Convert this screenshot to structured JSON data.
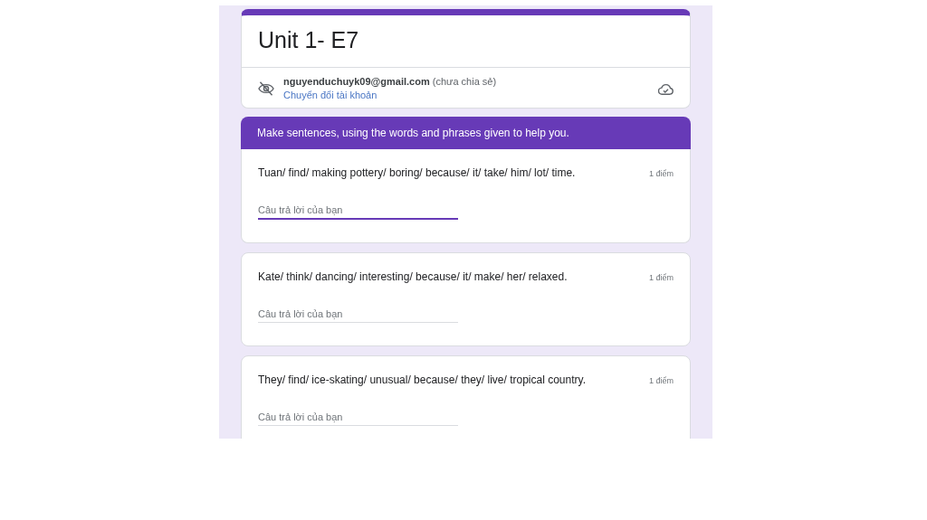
{
  "form": {
    "title": "Unit 1- E7",
    "account": {
      "email": "nguyenduchuyk09@gmail.com",
      "note": "(chưa chia sẻ)",
      "switch_link": "Chuyển đổi tài khoản"
    }
  },
  "section": {
    "title": "Make sentences, using the words and phrases given to help you."
  },
  "questions": [
    {
      "text": "Tuan/ find/ making pottery/ boring/ because/ it/ take/ him/ lot/ time.",
      "points": "1 điểm",
      "placeholder": "Câu trả lời của bạn",
      "focused": true
    },
    {
      "text": "Kate/ think/ dancing/ interesting/ because/ it/ make/ her/ relaxed.",
      "points": "1 điểm",
      "placeholder": "Câu trả lời của bạn",
      "focused": false
    },
    {
      "text": "They/ find/ ice-skating/ unusual/ because/ they/ live/ tropical country.",
      "points": "1 điểm",
      "placeholder": "Câu trả lời của bạn",
      "focused": false
    }
  ]
}
